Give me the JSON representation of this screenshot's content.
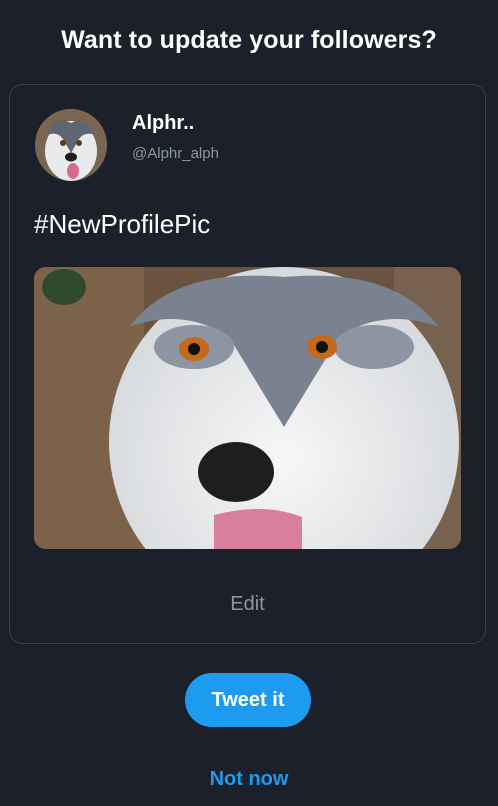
{
  "prompt": {
    "title": "Want to update your followers?"
  },
  "profile": {
    "name": "Alphr..",
    "handle": "@Alphr_alph"
  },
  "tweet": {
    "text": "#NewProfilePic"
  },
  "actions": {
    "edit_label": "Edit",
    "tweet_label": "Tweet it",
    "dismiss_label": "Not now"
  },
  "colors": {
    "background": "#1b202a",
    "accent": "#1d9bf0",
    "muted_text": "#8b96a3",
    "card_border": "#3a4352"
  }
}
